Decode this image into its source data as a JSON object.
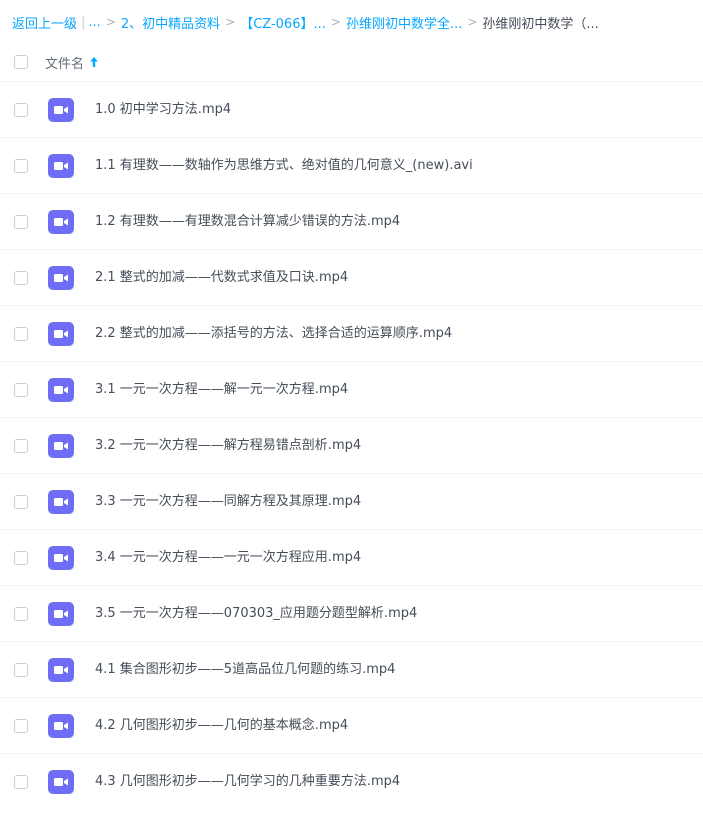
{
  "breadcrumb": {
    "back": "返回上一级",
    "pipe": "|",
    "ellipsis": "...",
    "sep": ">",
    "crumbs": [
      "2、初中精品资料",
      "【CZ-066】...",
      "孙维刚初中数学全..."
    ],
    "current": "孙维刚初中数学（..."
  },
  "header": {
    "column_name": "文件名",
    "sort_icon": "arrow-up-icon"
  },
  "files": [
    {
      "name": "1.0 初中学习方法.mp4"
    },
    {
      "name": "1.1 有理数——数轴作为思维方式、绝对值的几何意义_(new).avi"
    },
    {
      "name": "1.2 有理数——有理数混合计算减少错误的方法.mp4"
    },
    {
      "name": "2.1 整式的加减——代数式求值及口诀.mp4"
    },
    {
      "name": "2.2 整式的加减——添括号的方法、选择合适的运算顺序.mp4"
    },
    {
      "name": "3.1 一元一次方程——解一元一次方程.mp4"
    },
    {
      "name": "3.2 一元一次方程——解方程易错点剖析.mp4"
    },
    {
      "name": "3.3 一元一次方程——同解方程及其原理.mp4"
    },
    {
      "name": "3.4 一元一次方程——一元一次方程应用.mp4"
    },
    {
      "name": "3.5 一元一次方程——070303_应用题分题型解析.mp4"
    },
    {
      "name": "4.1 集合图形初步——5道高品位几何题的练习.mp4"
    },
    {
      "name": "4.2 几何图形初步——几何的基本概念.mp4"
    },
    {
      "name": "4.3 几何图形初步——几何学习的几种重要方法.mp4"
    }
  ],
  "icons": {
    "file_icon": "video-file-icon"
  },
  "colors": {
    "link": "#06a7ff",
    "video_icon": "#6f6cf6",
    "text": "#454d5a"
  }
}
